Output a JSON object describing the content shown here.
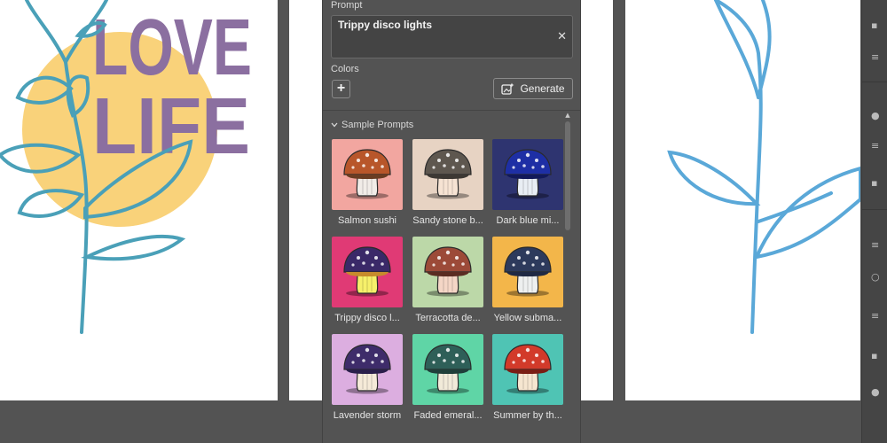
{
  "panel": {
    "prompt_label": "Prompt",
    "prompt_value": "Trippy disco lights",
    "clear_icon": "close-icon",
    "colors_label": "Colors",
    "add_icon": "plus-icon",
    "generate_label": "Generate",
    "generate_icon": "sparkle-image-icon",
    "section_title": "Sample Prompts",
    "section_icon": "chevron-down-icon",
    "samples": [
      {
        "label": "Salmon sushi",
        "bg": "#f2a6a0",
        "cap": "#b8562a",
        "stem": "#f1ece8",
        "gill": "#6a3c22"
      },
      {
        "label": "Sandy stone b...",
        "bg": "#e7d3c3",
        "cap": "#5e574f",
        "stem": "#f6e3d3",
        "gill": "#3d3833"
      },
      {
        "label": "Dark blue mi...",
        "bg": "#2e3470",
        "cap": "#1e2fa5",
        "stem": "#e9eef4",
        "gill": "#12195a"
      },
      {
        "label": "Trippy disco l...",
        "bg": "#e03a75",
        "cap": "#3a2968",
        "stem": "#f6f06a",
        "gill": "#c78b2c"
      },
      {
        "label": "Terracotta de...",
        "bg": "#bcd8a8",
        "cap": "#9c4a38",
        "stem": "#f4d6c6",
        "gill": "#5a2c22"
      },
      {
        "label": "Yellow subma...",
        "bg": "#f3b64a",
        "cap": "#2d3a5c",
        "stem": "#eef0f0",
        "gill": "#1f2944"
      },
      {
        "label": "Lavender storm",
        "bg": "#dcaee0",
        "cap": "#3e2c6a",
        "stem": "#f5ead8",
        "gill": "#2a1e4a"
      },
      {
        "label": "Faded emeral...",
        "bg": "#5fd5a6",
        "cap": "#2e5f58",
        "stem": "#f1ead9",
        "gill": "#1f3f3a"
      },
      {
        "label": "Summer by th...",
        "bg": "#4fc4b4",
        "cap": "#d23a2a",
        "stem": "#f6e6d0",
        "gill": "#7a1e14"
      }
    ]
  },
  "artboards": {
    "poster_line1": "LOVE",
    "poster_line2": "LIFE",
    "poster_text_color": "#8b6fa0",
    "sun_color": "#f9d27a",
    "leaf_color": "#4aa0b8",
    "sprout_color": "#5aa8d8"
  },
  "right_strip_icons": [
    "panel-icon",
    "align-icon",
    "layers-icon",
    "properties-icon",
    "swatch-icon",
    "adjust-icon",
    "brush-icon"
  ]
}
